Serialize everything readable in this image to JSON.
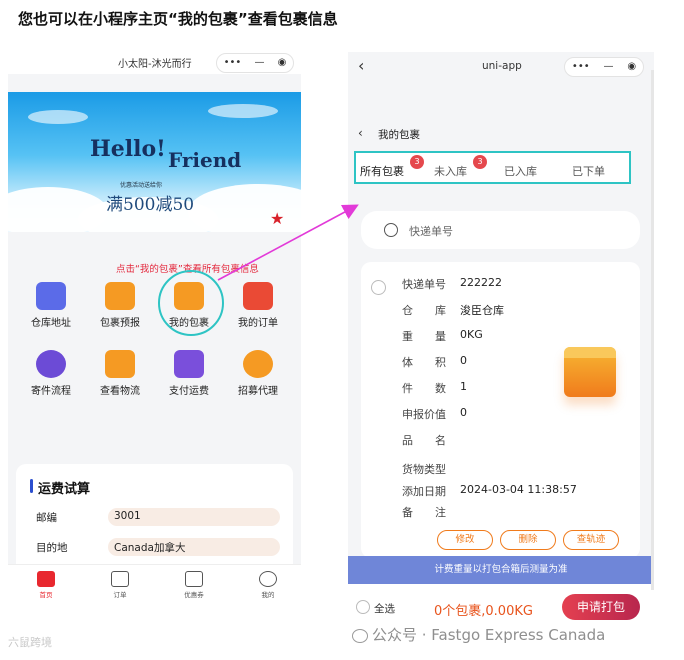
{
  "headline": "您也可以在小程序主页“我的包裹”查看包裹信息",
  "left_phone": {
    "title": "小太阳-沐光而行",
    "capsule": {
      "more": "•••",
      "minimize": "—",
      "close": "◉"
    },
    "banner": {
      "hello": "Hello!",
      "friend": "Friend",
      "small": "优惠活动送给你",
      "offer": "满500减50"
    },
    "callout": "点击“我的包裹”查看所有包裹信息",
    "grid": [
      {
        "label": "仓库地址",
        "icon": "map-icon",
        "color": "#5b6be8"
      },
      {
        "label": "包裹预报",
        "icon": "deer-box-icon",
        "color": "#f59a23"
      },
      {
        "label": "我的包裹",
        "icon": "truck-icon",
        "color": "#f59a23"
      },
      {
        "label": "我的订单",
        "icon": "order-box-icon",
        "color": "#ea4a35"
      },
      {
        "label": "寄件流程",
        "icon": "person-icon",
        "color": "#6c4bd6"
      },
      {
        "label": "查看物流",
        "icon": "delivery-truck-icon",
        "color": "#f59a23"
      },
      {
        "label": "支付运费",
        "icon": "wallet-icon",
        "color": "#7a4fdb"
      },
      {
        "label": "招募代理",
        "icon": "people-icon",
        "color": "#f59a23"
      }
    ],
    "calc": {
      "title": "运费试算",
      "rows": [
        {
          "label": "邮编",
          "value": "3001"
        },
        {
          "label": "目的地",
          "value": "Canada加拿大"
        }
      ]
    },
    "tabs": [
      {
        "label": "首页",
        "active": true
      },
      {
        "label": "订单",
        "active": false
      },
      {
        "label": "优惠券",
        "active": false
      },
      {
        "label": "我的",
        "active": false
      }
    ]
  },
  "right_phone": {
    "title": "uni-app",
    "capsule": {
      "more": "•••",
      "minimize": "—",
      "close": "◉"
    },
    "subnav_title": "我的包裹",
    "status_tabs": [
      {
        "label": "所有包裹",
        "badge": "3"
      },
      {
        "label": "未入库",
        "badge": "3"
      },
      {
        "label": "已入库",
        "badge": ""
      },
      {
        "label": "已下单",
        "badge": ""
      }
    ],
    "search_placeholder": "快递单号",
    "package": {
      "fields": [
        {
          "label": "快递单号",
          "value": "222222"
        },
        {
          "label": "仓　　库",
          "value": "浚臣仓库"
        },
        {
          "label": "重　　量",
          "value": "0KG"
        },
        {
          "label": "体　　积",
          "value": "0"
        },
        {
          "label": "件　　数",
          "value": "1"
        },
        {
          "label": "申报价值",
          "value": "0"
        },
        {
          "label": "品　　名",
          "value": ""
        },
        {
          "label": "货物类型",
          "value": ""
        },
        {
          "label": "添加日期",
          "value": "2024-03-04 11:38:57"
        },
        {
          "label": "备　　注",
          "value": ""
        }
      ],
      "actions": [
        "修改",
        "删除",
        "查轨迹"
      ]
    },
    "notice": "计费重量以打包合箱后测量为准",
    "select_all": "全选",
    "total": "0个包裹,0.00KG",
    "pack_button": "申请打包"
  },
  "watermark_left": "六鼠跨境",
  "watermark_right": "公众号 · Fastgo Express Canada",
  "colors": {
    "highlight": "#2ec4c4",
    "arrow": "#e23ad8",
    "accent": "#f07b1c",
    "badge": "#e5484d"
  }
}
